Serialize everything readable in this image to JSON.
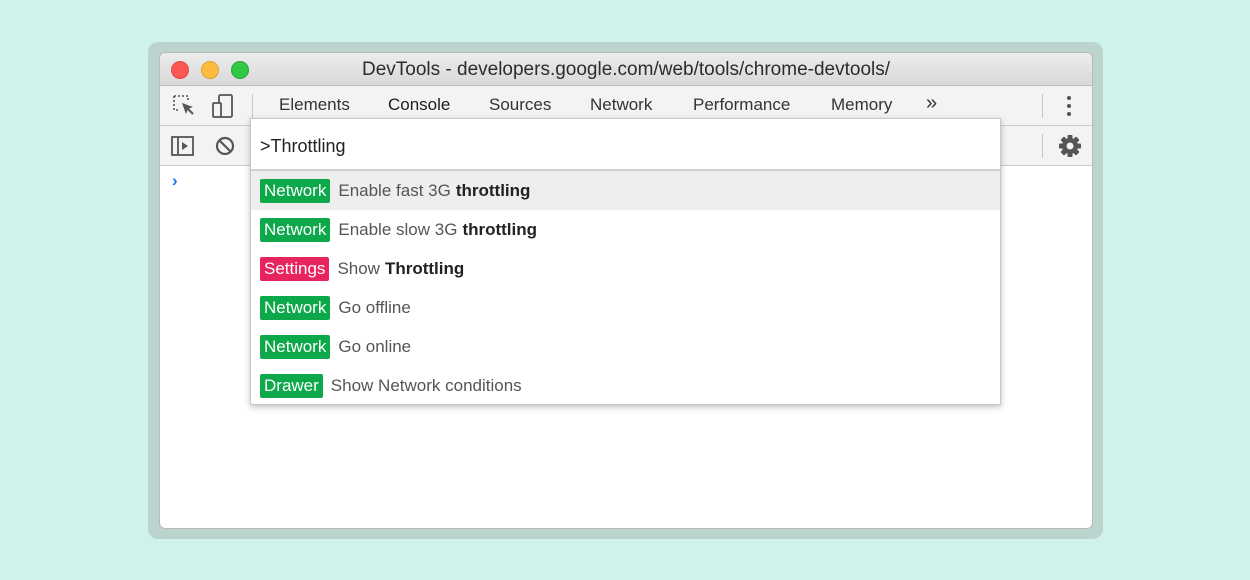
{
  "window": {
    "title": "DevTools - developers.google.com/web/tools/chrome-devtools/"
  },
  "tabs": [
    {
      "label": "Elements"
    },
    {
      "label": "Console"
    },
    {
      "label": "Sources"
    },
    {
      "label": "Network"
    },
    {
      "label": "Performance"
    },
    {
      "label": "Memory"
    }
  ],
  "more_tabs": "»",
  "console": {
    "prompt": "›"
  },
  "command_menu": {
    "input_value": ">Throttling",
    "items": [
      {
        "badge": "Network",
        "badge_color": "#0ca84a",
        "text": "Enable fast 3G",
        "match": "throttling",
        "selected": true
      },
      {
        "badge": "Network",
        "badge_color": "#0ca84a",
        "text": "Enable slow 3G",
        "match": "throttling"
      },
      {
        "badge": "Settings",
        "badge_color": "#e8245f",
        "text": "Show",
        "match": "Throttling"
      },
      {
        "badge": "Network",
        "badge_color": "#0ca84a",
        "text": "Go offline",
        "match": ""
      },
      {
        "badge": "Network",
        "badge_color": "#0ca84a",
        "text": "Go online",
        "match": ""
      },
      {
        "badge": "Drawer",
        "badge_color": "#0ca84a",
        "text": "Show Network conditions",
        "match": ""
      }
    ]
  },
  "icons": {
    "inspect": "inspect-element-icon",
    "device": "device-toolbar-icon",
    "sidebar": "show-sidebar-icon",
    "clear": "clear-console-icon",
    "settings": "gear-icon",
    "menu": "kebab-menu-icon"
  }
}
